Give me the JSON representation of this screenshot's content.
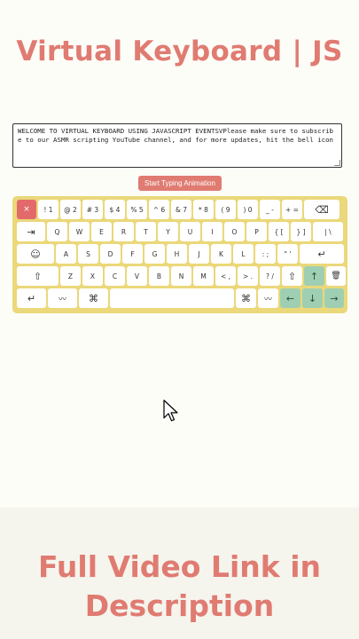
{
  "header": {
    "title": "Virtual Keyboard | JS"
  },
  "editor": {
    "text": "WELCOME TO VIRTUAL KEYBOARD USING JAVASCRIPT EVENTSVPlease make sure to subscribe to our ASMR scripting YouTube channel, and for more updates, hit the bell icon"
  },
  "controls": {
    "animation_button": "Start Typing Animation"
  },
  "keyboard": {
    "row1": [
      "×",
      "! 1",
      "@ 2",
      "# 3",
      "$ 4",
      "% 5",
      "^ 6",
      "& 7",
      "* 8",
      "( 9",
      ") 0",
      "_ -",
      "+ =",
      "⌫"
    ],
    "row2": [
      "⇥",
      "Q",
      "W",
      "E",
      "R",
      "T",
      "Y",
      "U",
      "I",
      "O",
      "P",
      "{ [",
      "} ]",
      "| \\"
    ],
    "row3": [
      "☺",
      "A",
      "S",
      "D",
      "F",
      "G",
      "H",
      "J",
      "K",
      "L",
      ": ;",
      "\" '",
      "↵"
    ],
    "row4": [
      "⇧",
      "Z",
      "X",
      "C",
      "V",
      "B",
      "N",
      "M",
      "< ,",
      "> .",
      "? /",
      "⇧",
      "↑",
      "🗑"
    ],
    "row5": [
      "↵",
      "〰",
      "⌘",
      "",
      "⌘",
      "〰",
      "←",
      "↓",
      "→"
    ]
  },
  "footer": {
    "line1": "Full Video Link in",
    "line2": "Description"
  },
  "colors": {
    "accent": "#e07b72",
    "keyboard_bg": "#ead87a",
    "arrow_keys": "#9fcfb3",
    "escape_key": "#e36a6a"
  }
}
